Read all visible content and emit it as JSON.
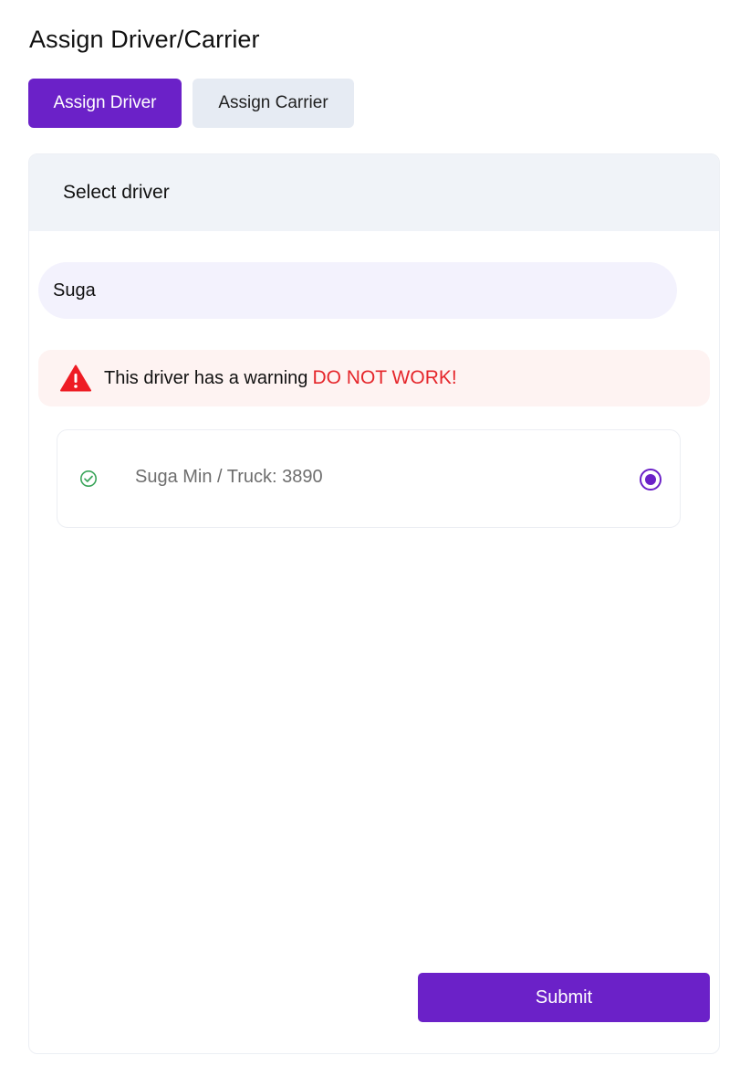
{
  "page": {
    "title": "Assign Driver/Carrier"
  },
  "tabs": {
    "assign_driver": "Assign Driver",
    "assign_carrier": "Assign Carrier",
    "active": "assign_driver"
  },
  "panel": {
    "header_title": "Select driver",
    "search": {
      "value": "Suga",
      "placeholder": ""
    },
    "warning": {
      "text": "This driver has a warning",
      "emphasis": "DO NOT WORK!",
      "icon": "warning-triangle-icon"
    },
    "drivers": [
      {
        "label": "Suga Min / Truck: 3890",
        "status_icon": "check-circle-icon",
        "selected": true
      }
    ],
    "submit_label": "Submit"
  },
  "colors": {
    "accent": "#6b21c8",
    "warning_text": "#e5262b",
    "warning_bg": "#fef3f2",
    "success": "#3aa55a",
    "tab_inactive_bg": "#e6ebf3",
    "search_bg": "#f3f2fd",
    "header_bg": "#f0f3f8"
  }
}
